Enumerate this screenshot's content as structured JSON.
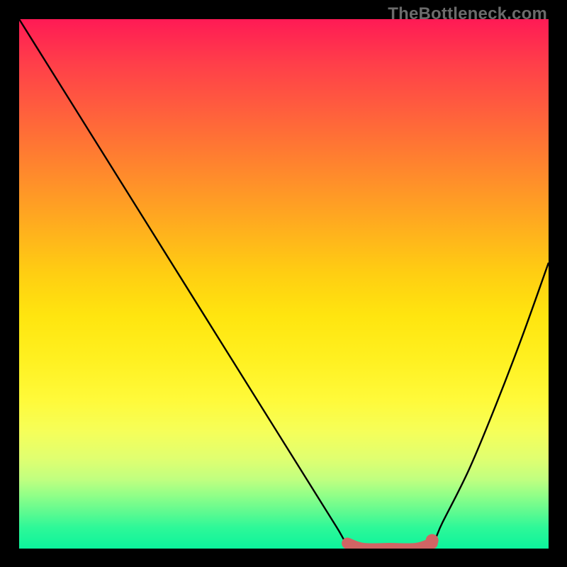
{
  "watermark": "TheBottleneck.com",
  "chart_data": {
    "type": "line",
    "title": "",
    "xlabel": "",
    "ylabel": "",
    "xlim": [
      0,
      100
    ],
    "ylim": [
      0,
      100
    ],
    "series": [
      {
        "name": "bottleneck-curve",
        "x": [
          0,
          5,
          10,
          15,
          20,
          25,
          30,
          35,
          40,
          45,
          50,
          55,
          60,
          62,
          65,
          70,
          75,
          78,
          80,
          85,
          90,
          95,
          100
        ],
        "y": [
          100,
          92,
          84,
          76,
          68,
          60,
          52,
          44,
          36,
          28,
          20,
          12,
          4,
          1,
          0,
          0,
          0,
          1,
          5,
          15,
          27,
          40,
          54
        ]
      },
      {
        "name": "optimum-band",
        "x": [
          62,
          65,
          70,
          75,
          78
        ],
        "y": [
          1,
          0,
          0,
          0,
          1
        ]
      }
    ],
    "annotations": []
  },
  "colors": {
    "curve": "#000000",
    "band": "#d16464",
    "plot_border": "#000000"
  }
}
